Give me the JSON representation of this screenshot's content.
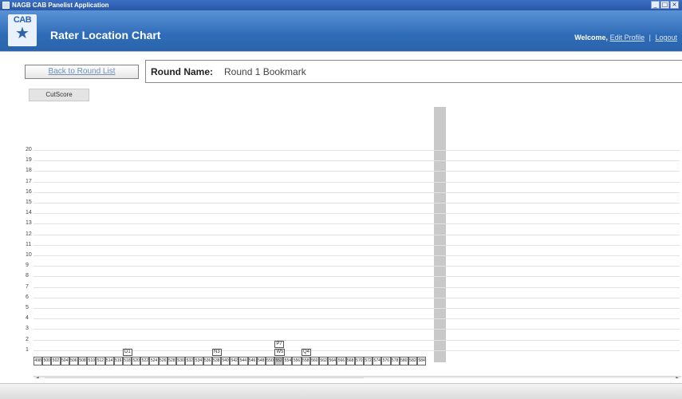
{
  "window": {
    "title": "NAGB CAB Panelist Application",
    "minimize": "_",
    "maximize": "□",
    "close": "×"
  },
  "header": {
    "logo": "CAB",
    "logo_icon": "star-icon",
    "title": "Rater Location Chart",
    "welcome": "Welcome,",
    "user_link": "Edit Profile",
    "separator": "|",
    "logout": "Logout"
  },
  "toolbar": {
    "back_label": "Back to Round List",
    "round_name_label": "Round Name:",
    "round_name_value": "Round 1 Bookmark",
    "tab_cutscore": "CutScore"
  },
  "chart_data": {
    "type": "table",
    "ylabels": [
      "20",
      "19",
      "18",
      "17",
      "16",
      "15",
      "14",
      "13",
      "12",
      "11",
      "10",
      "9",
      "8",
      "7",
      "6",
      "5",
      "4",
      "3",
      "2",
      "1"
    ],
    "score_scale": [
      "498",
      "500",
      "502",
      "504",
      "506",
      "508",
      "510",
      "512",
      "514",
      "516",
      "518",
      "520",
      "522",
      "524",
      "526",
      "528",
      "530",
      "532",
      "534",
      "536",
      "538",
      "540",
      "542",
      "544",
      "546",
      "548",
      "550",
      "552",
      "554",
      "556",
      "558",
      "560",
      "562",
      "564",
      "566",
      "568",
      "570",
      "572",
      "574",
      "576",
      "578",
      "580",
      "582",
      "584"
    ],
    "cut_score": "552",
    "raters": [
      {
        "label": "D1",
        "score": "518",
        "level": 1
      },
      {
        "label": "N3",
        "score": "538",
        "level": 1
      },
      {
        "label": "P7",
        "score": "552",
        "level": 2
      },
      {
        "label": "W5",
        "score": "552",
        "level": 1
      },
      {
        "label": "Q4",
        "score": "558",
        "level": 1
      }
    ]
  },
  "scrollbar": {
    "left_arrow": "◀",
    "right_arrow": "▶"
  }
}
